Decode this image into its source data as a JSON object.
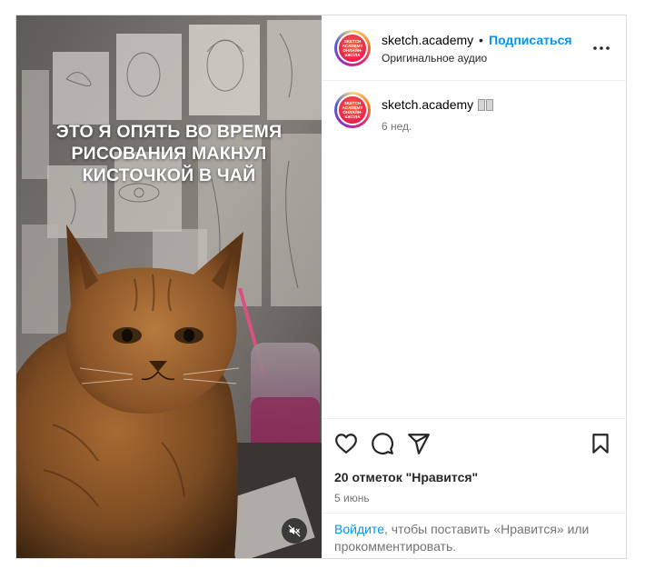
{
  "account": {
    "username": "sketch.academy",
    "dot": "•",
    "follow_label": "Подписаться",
    "audio_label": "Оригинальное аудио",
    "avatar_text": [
      "SKETCH",
      "ACADEMY",
      "ОНЛАЙН-ШКОЛА"
    ]
  },
  "media": {
    "caption_lines": [
      "ЭТО Я ОПЯТЬ ВО ВРЕМЯ",
      "РИСОВАНИЯ МАКНУЛ",
      "КИСТОЧКОЙ В ЧАЙ"
    ],
    "mute_icon": "speaker-muted-icon"
  },
  "comment": {
    "username": "sketch.academy",
    "time": "6 нед."
  },
  "actions": {
    "like_icon": "heart-icon",
    "comment_icon": "comment-icon",
    "share_icon": "share-icon",
    "save_icon": "bookmark-icon",
    "likes_text": "20 отметок \"Нравится\"",
    "date": "5 июнь"
  },
  "login": {
    "link": "Войдите",
    "rest": ", чтобы поставить «Нравится» или прокомментировать."
  },
  "colors": {
    "accent": "#0095f6",
    "text": "#262626",
    "secondary": "#737373",
    "border": "#dbdbdb"
  }
}
